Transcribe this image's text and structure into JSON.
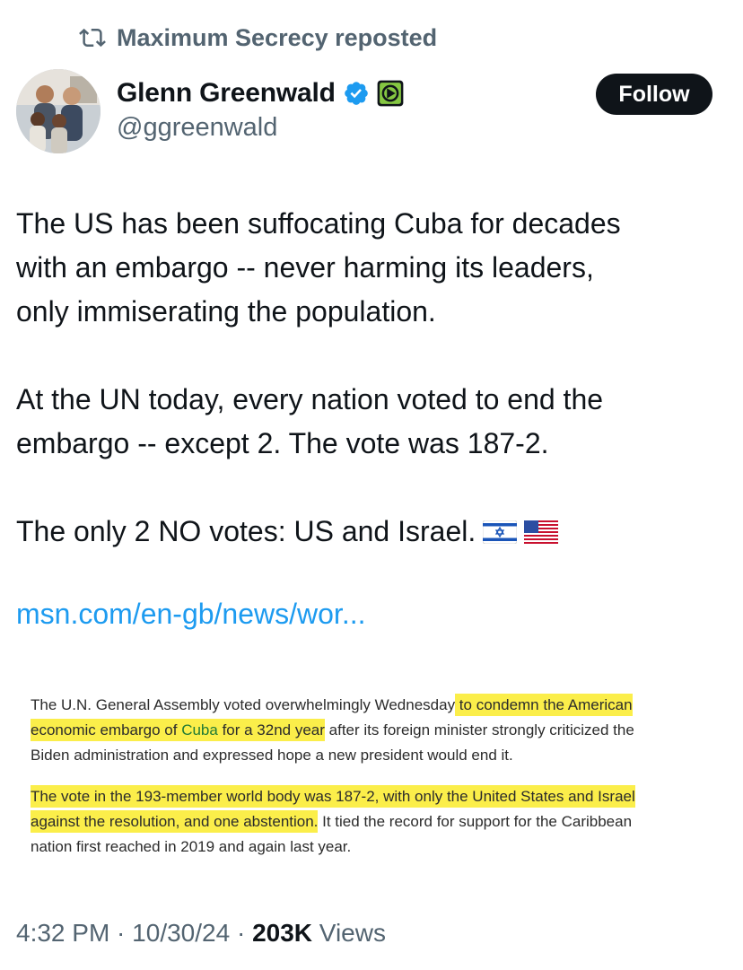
{
  "repost": {
    "icon": "repost-icon",
    "text": "Maximum Secrecy reposted"
  },
  "author": {
    "display_name": "Glenn Greenwald",
    "handle": "@ggreenwald",
    "verified_icon": "verified-badge-icon",
    "affiliation_icon": "rumble-affiliate-icon",
    "follow_label": "Follow"
  },
  "tweet": {
    "line1": "The US has been suffocating Cuba for decades",
    "line2": "with an embargo -- never harming its leaders,",
    "line3": "only immiserating the population.",
    "line4": "At the UN today, every nation voted to end the",
    "line5": "embargo -- except 2. The vote was 187-2.",
    "line6": "The only 2 NO votes: US and Israel.",
    "flags": [
      "israel-flag-icon",
      "us-flag-icon"
    ],
    "link": "msn.com/en-gb/news/wor..."
  },
  "article": {
    "p1_a": "The U.N. General Assembly voted overwhelmingly Wednesday",
    "p1_hl_a": " to condemn the American",
    "p1_hl_b": "economic embargo of ",
    "p1_hl_cuba": "Cuba",
    "p1_hl_c": " for a 32nd year",
    "p1_b": " after its foreign minister strongly criticized the",
    "p1_c": "Biden administration and expressed hope a new president would end it.",
    "p2_hl_a": "The vote in the 193-member world body was 187-2, with only the United States and Israel",
    "p2_hl_b": "against the resolution, and one abstention.",
    "p2_a": " It tied the record for support for the Caribbean",
    "p2_b": "nation first reached in 2019 and again last year.",
    "highlight_color": "#fbee4a"
  },
  "meta": {
    "time": "4:32 PM",
    "separator": " · ",
    "date": "10/30/24",
    "views_count": "203K",
    "views_label": " Views"
  },
  "colors": {
    "text": "#0f1419",
    "secondary": "#536471",
    "link": "#1d9bf0",
    "verified": "#1d9bf0",
    "follow_bg": "#0f1419"
  }
}
